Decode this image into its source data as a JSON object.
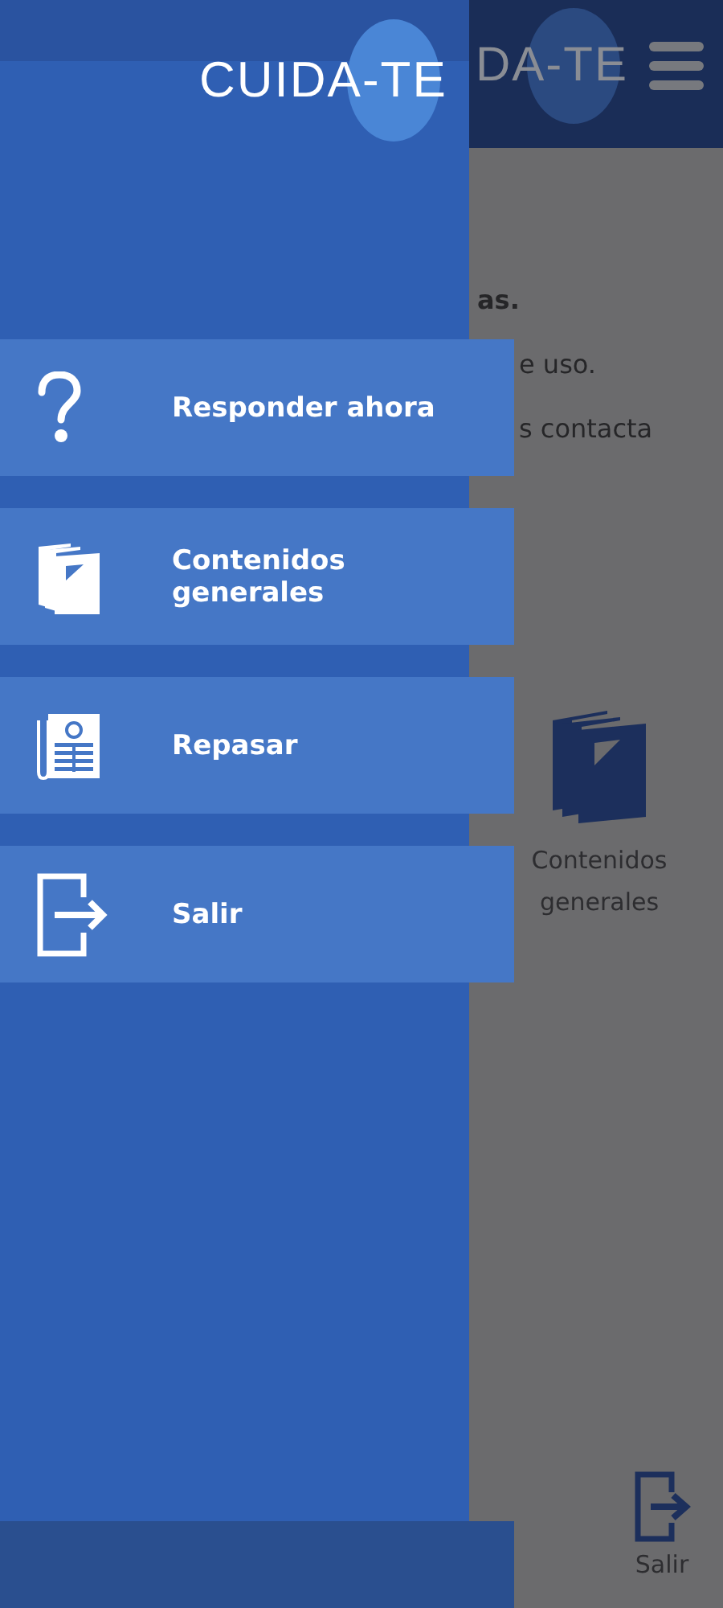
{
  "background": {
    "logo": "DA-TE",
    "lines": [
      "as.",
      "e uso.",
      "s contacta"
    ],
    "tile": {
      "kind": "books",
      "label": "Contenidos generales"
    },
    "bottom": {
      "kind": "exit",
      "label": "Salir"
    }
  },
  "drawer": {
    "logo": "CUIDA-TE",
    "items": [
      {
        "kind": "question",
        "label": "Responder ahora"
      },
      {
        "kind": "books",
        "label": "Contenidos generales"
      },
      {
        "kind": "newspaper",
        "label": "Repasar"
      },
      {
        "kind": "exit",
        "label": "Salir"
      }
    ]
  }
}
